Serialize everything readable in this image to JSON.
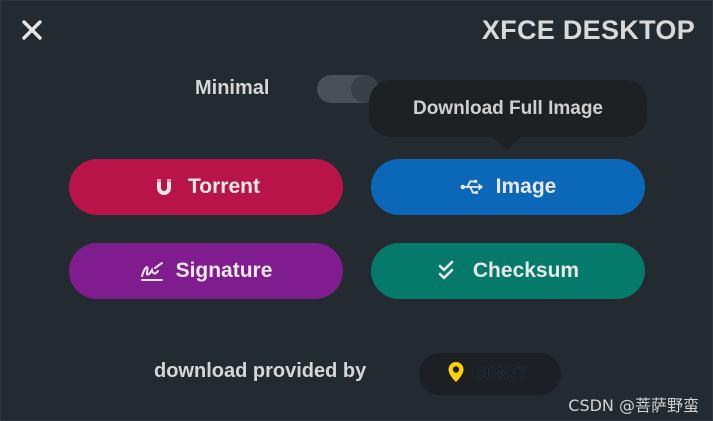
{
  "header": {
    "title": "XFCE DESKTOP",
    "close_icon": "close-icon"
  },
  "options": {
    "minimal_label": "Minimal",
    "minimal_enabled": false
  },
  "tooltip": {
    "text": "Download Full Image"
  },
  "buttons": {
    "torrent": {
      "label": "Torrent",
      "icon": "magnet-icon",
      "color": "#b9144a"
    },
    "image": {
      "label": "Image",
      "icon": "usb-icon",
      "color": "#0b68b9"
    },
    "signature": {
      "label": "Signature",
      "icon": "signature-icon",
      "color": "#7f1d8e"
    },
    "checksum": {
      "label": "Checksum",
      "icon": "double-check-icon",
      "color": "#057a6b"
    }
  },
  "footer": {
    "provided_by": "download provided by",
    "cdn_name": "CDN77",
    "cdn_icon": "location-pin-icon",
    "cdn_accent": "#ffd200"
  },
  "watermark": "CSDN @菩萨野蛮"
}
